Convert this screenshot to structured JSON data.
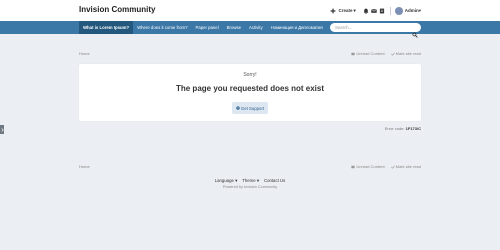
{
  "header": {
    "brand": "Invision Community",
    "create_label": "Create",
    "user_name": "Admin"
  },
  "nav": {
    "items": [
      {
        "label": "What is Lorem Ipsum?"
      },
      {
        "label": "Where does it come from?"
      },
      {
        "label": "Paper panel"
      },
      {
        "label": "Browse"
      },
      {
        "label": "Activity"
      },
      {
        "label": "Номинация и Дипломатия"
      }
    ],
    "active_index": 0
  },
  "search": {
    "placeholder": "Search..."
  },
  "breadcrumb": {
    "home": "Home",
    "unread": "Unread Content",
    "mark_read": "Mark site read"
  },
  "error": {
    "sorry": "Sorry!",
    "title": "The page you requested does not exist",
    "support_label": "Get Support"
  },
  "error_code": {
    "label": "Error code:",
    "code": "1F173/C"
  },
  "footer": {
    "language": "Language",
    "theme": "Theme",
    "contact": "Contact Us",
    "powered": "Powered by Invision Community"
  },
  "colors": {
    "nav_bg": "#3b78a8",
    "nav_active": "#24587e",
    "page_bg": "#ebeef2",
    "button_bg": "#dde7f1"
  }
}
